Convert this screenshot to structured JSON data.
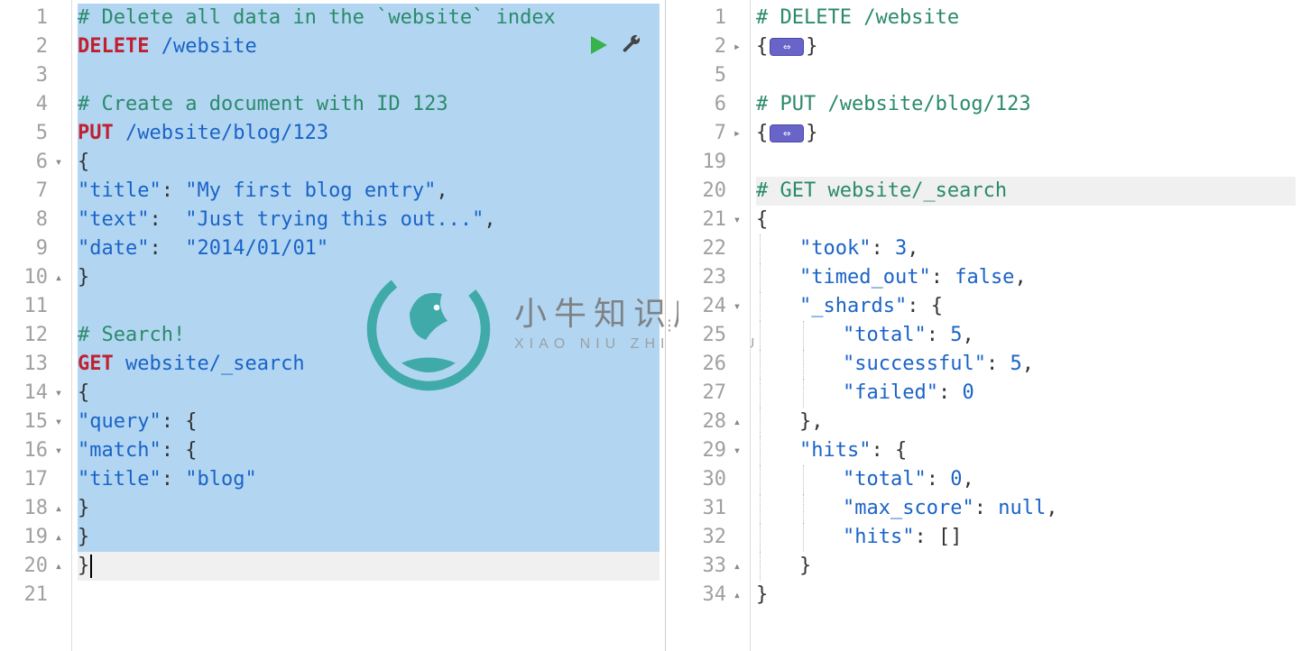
{
  "left": {
    "gutter": [
      {
        "n": "1"
      },
      {
        "n": "2"
      },
      {
        "n": "3"
      },
      {
        "n": "4"
      },
      {
        "n": "5"
      },
      {
        "n": "6",
        "fold": "open"
      },
      {
        "n": "7"
      },
      {
        "n": "8"
      },
      {
        "n": "9"
      },
      {
        "n": "10",
        "fold": "end"
      },
      {
        "n": "11"
      },
      {
        "n": "12"
      },
      {
        "n": "13"
      },
      {
        "n": "14",
        "fold": "open"
      },
      {
        "n": "15",
        "fold": "open"
      },
      {
        "n": "16",
        "fold": "open"
      },
      {
        "n": "17"
      },
      {
        "n": "18",
        "fold": "end"
      },
      {
        "n": "19",
        "fold": "end"
      },
      {
        "n": "20",
        "fold": "end"
      },
      {
        "n": "21"
      }
    ],
    "l1_comment": "# Delete all data in the `website` index",
    "l2_verb": "DELETE",
    "l2_path": " /website",
    "l4_comment": "# Create a document with ID 123",
    "l5_verb": "PUT",
    "l5_path": " /website/blog/123",
    "l6_brace": "{",
    "l7_key": "\"title\"",
    "l7_val": "\"My first blog entry\"",
    "l8_key": "\"text\"",
    "l8_val": "\"Just trying this out...\"",
    "l9_key": "\"date\"",
    "l9_val": "\"2014/01/01\"",
    "l10_brace": "}",
    "l12_comment": "# Search!",
    "l13_verb": "GET",
    "l13_path": " website/_search",
    "l14_brace": "{",
    "l15_key": "\"query\"",
    "l15_brace": "{",
    "l16_key": "\"match\"",
    "l16_brace": "{",
    "l17_key": "\"title\"",
    "l17_val": "\"blog\"",
    "l18_brace": "}",
    "l19_brace": "}",
    "l20_brace": "}",
    "active_line": 20
  },
  "right": {
    "gutter": [
      {
        "n": "1"
      },
      {
        "n": "2",
        "fold": "closed"
      },
      {
        "n": "5"
      },
      {
        "n": "6"
      },
      {
        "n": "7",
        "fold": "closed"
      },
      {
        "n": "19"
      },
      {
        "n": "20"
      },
      {
        "n": "21",
        "fold": "open"
      },
      {
        "n": "22"
      },
      {
        "n": "23"
      },
      {
        "n": "24",
        "fold": "open"
      },
      {
        "n": "25"
      },
      {
        "n": "26"
      },
      {
        "n": "27"
      },
      {
        "n": "28",
        "fold": "end"
      },
      {
        "n": "29",
        "fold": "open"
      },
      {
        "n": "30"
      },
      {
        "n": "31"
      },
      {
        "n": "32"
      },
      {
        "n": "33",
        "fold": "end"
      },
      {
        "n": "34",
        "fold": "end"
      }
    ],
    "r1_comment": "# DELETE /website",
    "r6_comment": "# PUT /website/blog/123",
    "r20_comment": "# GET website/_search",
    "took_key": "\"took\"",
    "took_val": "3",
    "timed_out_key": "\"timed_out\"",
    "timed_out_val": "false",
    "shards_key": "\"_shards\"",
    "shards_total_key": "\"total\"",
    "shards_total_val": "5",
    "shards_success_key": "\"successful\"",
    "shards_success_val": "5",
    "shards_failed_key": "\"failed\"",
    "shards_failed_val": "0",
    "hits_key": "\"hits\"",
    "hits_total_key": "\"total\"",
    "hits_total_val": "0",
    "hits_max_key": "\"max_score\"",
    "hits_max_val": "null",
    "hits_hits_key": "\"hits\"",
    "hits_hits_val": "[]",
    "active_line": 20
  },
  "watermark": {
    "cn": "小牛知识库",
    "en": "XIAO NIU ZHI SHI KU"
  }
}
